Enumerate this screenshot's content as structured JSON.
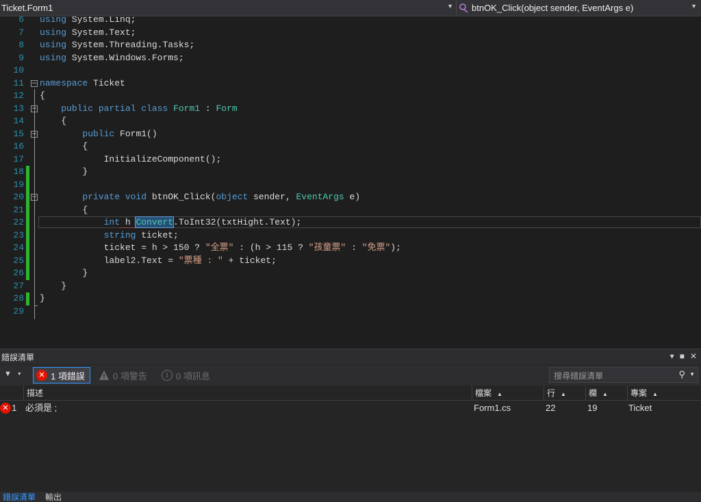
{
  "nav": {
    "class_selector": "Ticket.Form1",
    "member_selector": "btnOK_Click(object sender, EventArgs e)",
    "member_icon": "method-icon"
  },
  "editor": {
    "lines": [
      {
        "n": "6",
        "tokens": [
          {
            "t": "using",
            "c": "kw"
          },
          {
            "t": " System.Linq;",
            "c": ""
          }
        ]
      },
      {
        "n": "7",
        "tokens": [
          {
            "t": "using",
            "c": "kw"
          },
          {
            "t": " System.Text;",
            "c": ""
          }
        ]
      },
      {
        "n": "8",
        "tokens": [
          {
            "t": "using",
            "c": "kw"
          },
          {
            "t": " System.Threading.Tasks;",
            "c": ""
          }
        ]
      },
      {
        "n": "9",
        "tokens": [
          {
            "t": "using",
            "c": "kw"
          },
          {
            "t": " System.Windows.Forms;",
            "c": ""
          }
        ]
      },
      {
        "n": "10",
        "tokens": []
      },
      {
        "n": "11",
        "tokens": [
          {
            "t": "namespace",
            "c": "kw"
          },
          {
            "t": " Ticket",
            "c": ""
          }
        ]
      },
      {
        "n": "12",
        "tokens": [
          {
            "t": "{",
            "c": ""
          }
        ]
      },
      {
        "n": "13",
        "tokens": [
          {
            "t": "    ",
            "c": ""
          },
          {
            "t": "public partial class",
            "c": "kw"
          },
          {
            "t": " ",
            "c": ""
          },
          {
            "t": "Form1",
            "c": "ty"
          },
          {
            "t": " : ",
            "c": ""
          },
          {
            "t": "Form",
            "c": "ty"
          }
        ]
      },
      {
        "n": "14",
        "tokens": [
          {
            "t": "    {",
            "c": ""
          }
        ]
      },
      {
        "n": "15",
        "tokens": [
          {
            "t": "        ",
            "c": ""
          },
          {
            "t": "public",
            "c": "kw"
          },
          {
            "t": " Form1()",
            "c": ""
          }
        ]
      },
      {
        "n": "16",
        "tokens": [
          {
            "t": "        {",
            "c": ""
          }
        ]
      },
      {
        "n": "17",
        "tokens": [
          {
            "t": "            InitializeComponent();",
            "c": ""
          }
        ]
      },
      {
        "n": "18",
        "tokens": [
          {
            "t": "        }",
            "c": ""
          }
        ]
      },
      {
        "n": "19",
        "tokens": []
      },
      {
        "n": "20",
        "tokens": [
          {
            "t": "        ",
            "c": ""
          },
          {
            "t": "private void",
            "c": "kw"
          },
          {
            "t": " btnOK_Click(",
            "c": ""
          },
          {
            "t": "object",
            "c": "kw"
          },
          {
            "t": " sender, ",
            "c": ""
          },
          {
            "t": "EventArgs",
            "c": "ty"
          },
          {
            "t": " e)",
            "c": ""
          }
        ]
      },
      {
        "n": "21",
        "tokens": [
          {
            "t": "        {",
            "c": ""
          }
        ]
      },
      {
        "n": "22",
        "tokens": [
          {
            "t": "            ",
            "c": ""
          },
          {
            "t": "int",
            "c": "kw"
          },
          {
            "t": " h ",
            "c": "squig"
          },
          {
            "t": "Convert",
            "c": "ty conv-sel"
          },
          {
            "t": ".ToInt32(txtHight.Text);",
            "c": ""
          }
        ]
      },
      {
        "n": "23",
        "tokens": [
          {
            "t": "            ",
            "c": ""
          },
          {
            "t": "string",
            "c": "kw"
          },
          {
            "t": " ticket;",
            "c": ""
          }
        ]
      },
      {
        "n": "24",
        "tokens": [
          {
            "t": "            ticket = h > 150 ? ",
            "c": ""
          },
          {
            "t": "\"全票\"",
            "c": "st"
          },
          {
            "t": " : (h > 115 ? ",
            "c": ""
          },
          {
            "t": "\"孩童票\"",
            "c": "st"
          },
          {
            "t": " : ",
            "c": ""
          },
          {
            "t": "\"免票\"",
            "c": "st"
          },
          {
            "t": ");",
            "c": ""
          }
        ]
      },
      {
        "n": "25",
        "tokens": [
          {
            "t": "            label2.Text = ",
            "c": ""
          },
          {
            "t": "\"票種 : \"",
            "c": "st"
          },
          {
            "t": " + ticket;",
            "c": ""
          }
        ]
      },
      {
        "n": "26",
        "tokens": [
          {
            "t": "        }",
            "c": ""
          }
        ]
      },
      {
        "n": "27",
        "tokens": [
          {
            "t": "    }",
            "c": ""
          }
        ]
      },
      {
        "n": "28",
        "tokens": [
          {
            "t": "}",
            "c": ""
          }
        ]
      },
      {
        "n": "29",
        "tokens": []
      }
    ],
    "changed_lines": [
      "18",
      "19",
      "20",
      "21",
      "22",
      "23",
      "24",
      "25",
      "26",
      "28"
    ],
    "fold_markers": [
      "11",
      "13",
      "15",
      "20"
    ],
    "current_line": "22"
  },
  "error_list": {
    "title": "錯誤清單",
    "filter_label": "▼",
    "errors_button": "1 項錯誤",
    "warnings_button": "0 項警告",
    "messages_button": "0 項訊息",
    "search_placeholder": "搜尋錯誤清單",
    "columns": {
      "desc": "描述",
      "file": "檔案",
      "line": "行",
      "col": "欄",
      "project": "專案"
    },
    "rows": [
      {
        "num": "1",
        "desc": "必須是 ;",
        "file": "Form1.cs",
        "line": "22",
        "col": "19",
        "project": "Ticket"
      }
    ]
  },
  "bottom_tabs": [
    "錯誤清單",
    "輸出"
  ],
  "colors": {
    "error_red": "#e51400",
    "accent_blue": "#3399ff",
    "changed_green": "#2fb52f"
  }
}
